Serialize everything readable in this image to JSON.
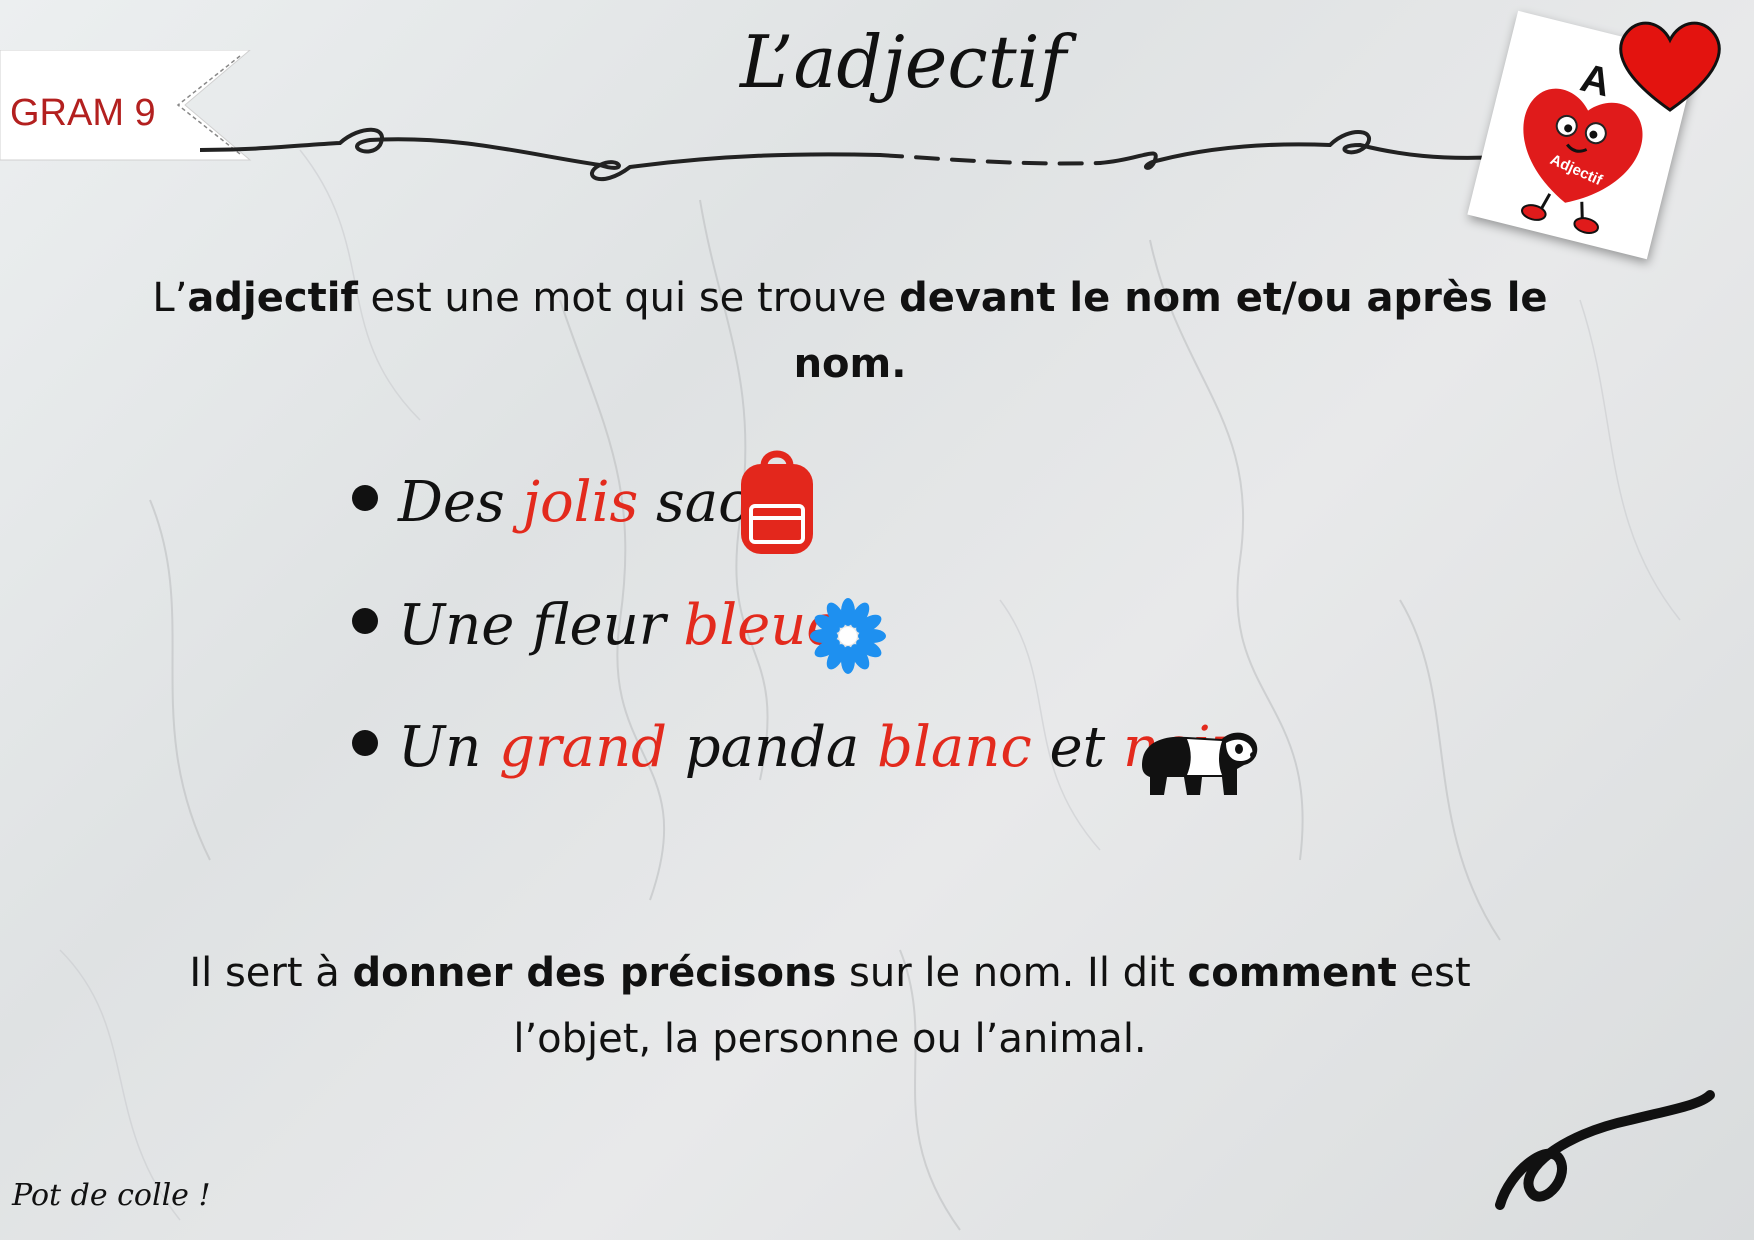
{
  "tag": {
    "label": "GRAM 9"
  },
  "title": "L’adjectif",
  "card": {
    "letter": "A",
    "label": "Adjectif"
  },
  "definition": {
    "p1": "L’",
    "p2": "adjectif",
    "p3": " est une mot qui se trouve ",
    "p4": "devant le nom et/ou après le nom",
    "p5": "."
  },
  "examples": [
    {
      "w1": "Des ",
      "w2": "jolis",
      "w3": " sacs"
    },
    {
      "w1": "Une fleur ",
      "w2": "bleue"
    },
    {
      "w1": "Un ",
      "w2": "grand",
      "w3": " panda ",
      "w4": "blanc",
      "w5": " et ",
      "w6": "noir"
    }
  ],
  "icons": [
    "backpack-icon",
    "flower-icon",
    "panda-icon"
  ],
  "explanation": {
    "p1": "Il sert à ",
    "p2": "donner des précisons",
    "p3": " sur le nom. Il dit ",
    "p4": "comment",
    "p5": " est l’objet, la personne ou l’animal."
  },
  "footer": "Pot de colle !",
  "colors": {
    "accent_red": "#e32a1d",
    "tag_red": "#b3201f",
    "flower_blue": "#1e90f0"
  }
}
